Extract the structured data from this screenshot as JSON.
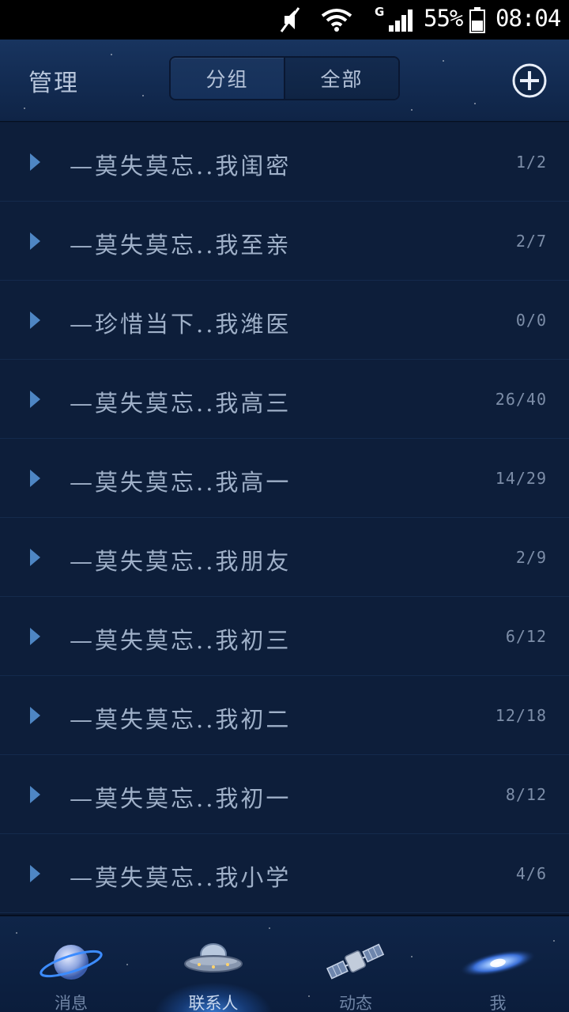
{
  "status_bar": {
    "battery_percent": "55%",
    "time": "08:04",
    "network_type": "G",
    "icons": [
      "mute-icon",
      "wifi-icon",
      "signal-icon",
      "battery-icon"
    ]
  },
  "header": {
    "manage_label": "管理",
    "segments": [
      "分组",
      "全部"
    ],
    "add_icon": "plus-circle-icon"
  },
  "groups": [
    {
      "name": "—莫失莫忘..我闺密",
      "count": "1/2"
    },
    {
      "name": "—莫失莫忘..我至亲",
      "count": "2/7"
    },
    {
      "name": "—珍惜当下..我潍医",
      "count": "0/0"
    },
    {
      "name": "—莫失莫忘..我高三",
      "count": "26/40"
    },
    {
      "name": "—莫失莫忘..我高一",
      "count": "14/29"
    },
    {
      "name": "—莫失莫忘..我朋友",
      "count": "2/9"
    },
    {
      "name": "—莫失莫忘..我初三",
      "count": "6/12"
    },
    {
      "name": "—莫失莫忘..我初二",
      "count": "12/18"
    },
    {
      "name": "—莫失莫忘..我初一",
      "count": "8/12"
    },
    {
      "name": "—莫失莫忘..我小学",
      "count": "4/6"
    }
  ],
  "bottom_nav": [
    {
      "label": "消息",
      "icon": "planet-icon",
      "active": false
    },
    {
      "label": "联系人",
      "icon": "ufo-icon",
      "active": true
    },
    {
      "label": "动态",
      "icon": "satellite-icon",
      "active": false
    },
    {
      "label": "我",
      "icon": "galaxy-icon",
      "active": false
    }
  ],
  "colors": {
    "background": "#0d1e3a",
    "header": "#15305a",
    "arrow": "#4e86c4",
    "active_glow": "#4696ff"
  }
}
